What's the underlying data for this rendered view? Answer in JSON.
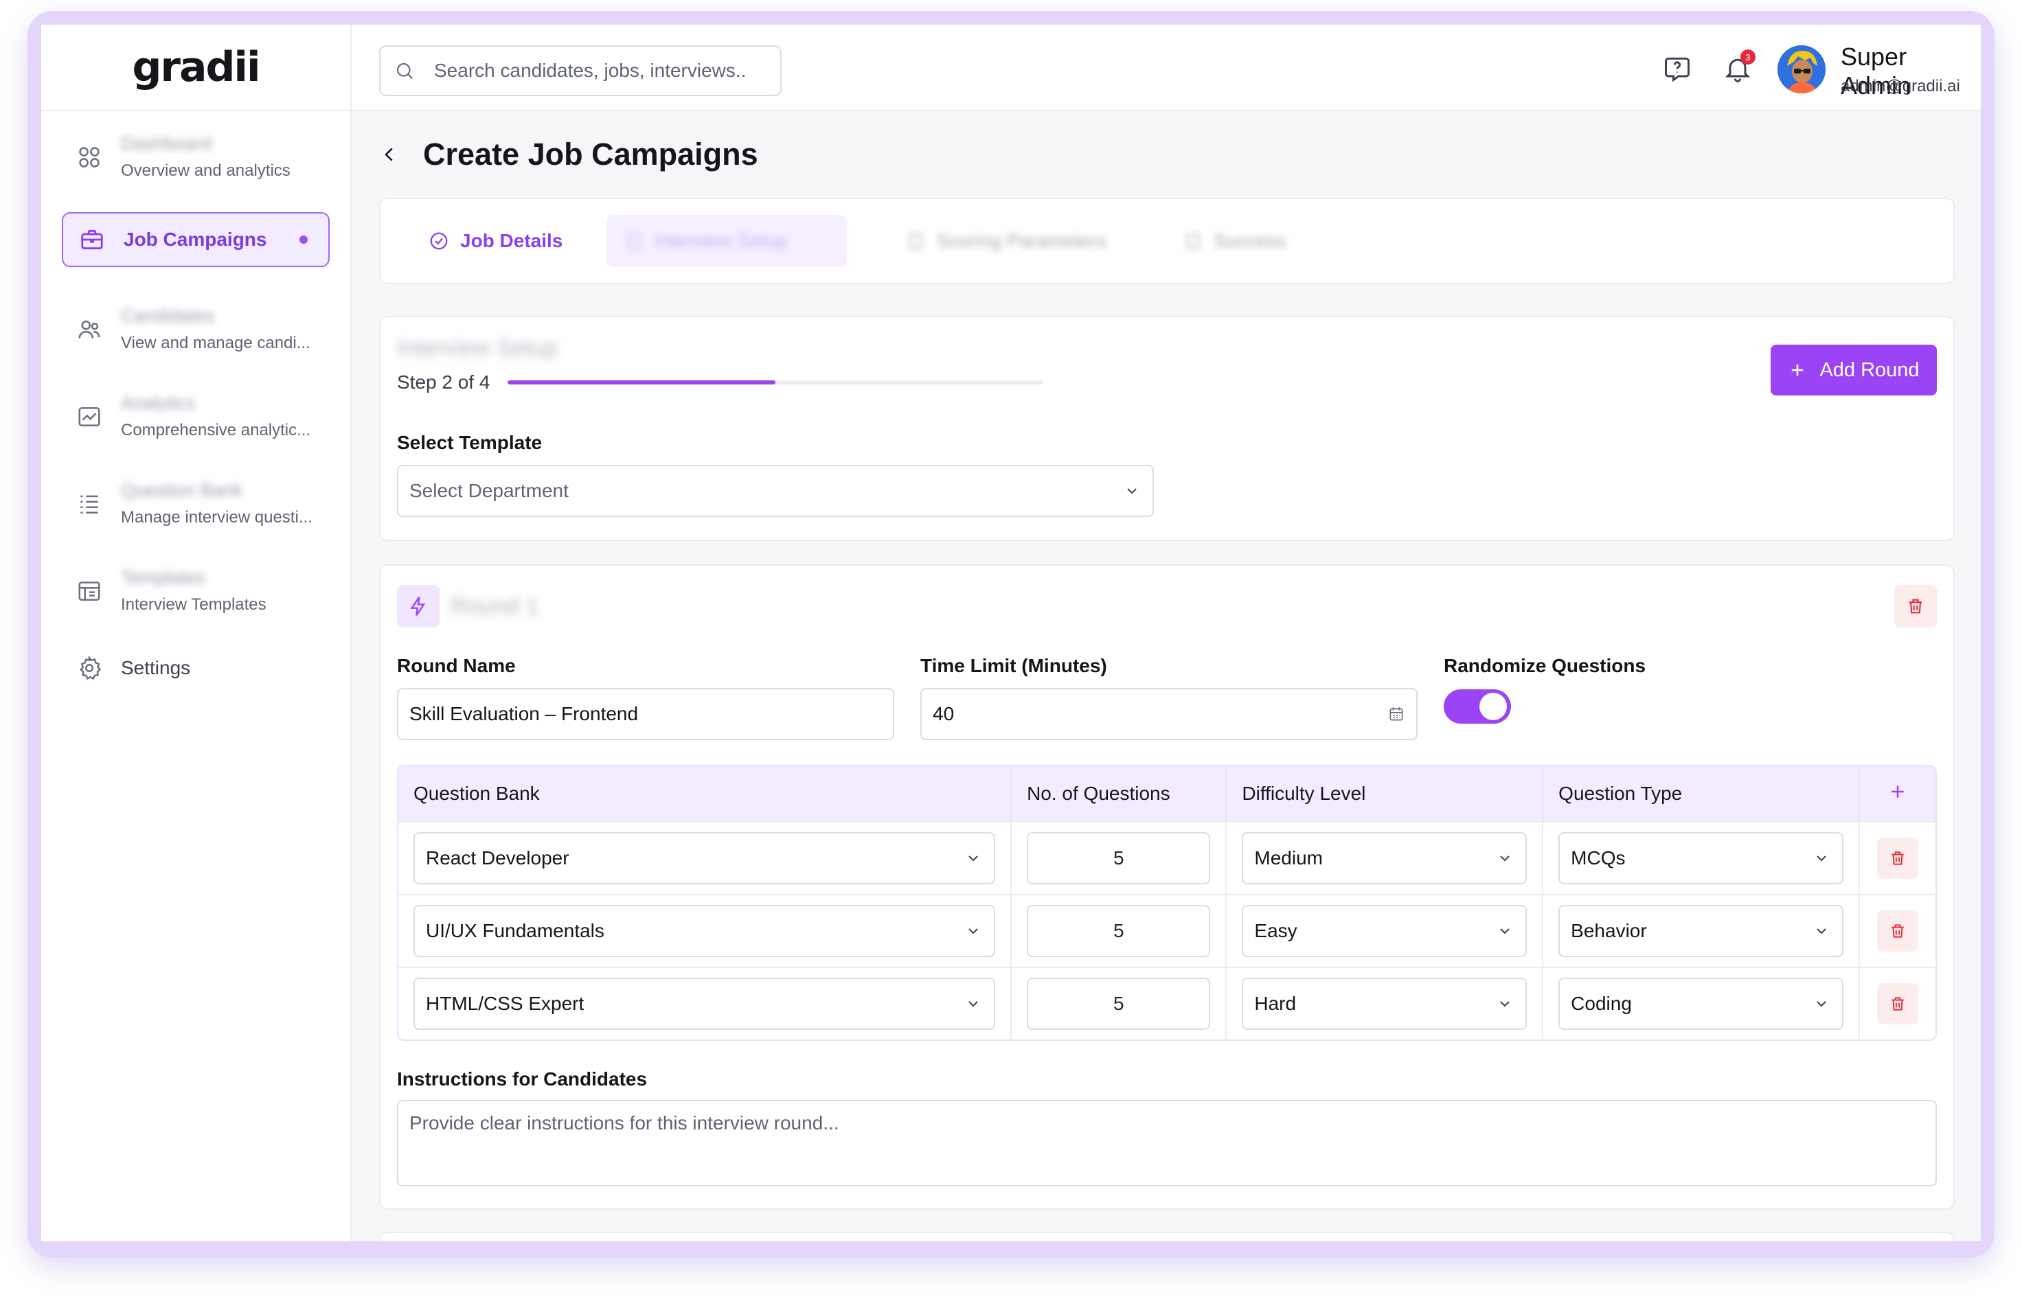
{
  "brand": {
    "logo": "gradii"
  },
  "search": {
    "placeholder": "Search candidates, jobs, interviews.."
  },
  "header": {
    "notification_count": "3",
    "user_name": "Super Admin",
    "user_email": "admin@gradii.ai"
  },
  "sidebar": {
    "items": [
      {
        "title": "Dashboard",
        "subtitle": "Overview and analytics",
        "icon": "grid-icon"
      },
      {
        "title": "Job Campaigns",
        "icon": "briefcase-icon",
        "active": true
      },
      {
        "title": "Candidates",
        "subtitle": "View and manage candi...",
        "icon": "users-icon"
      },
      {
        "title": "Analytics",
        "subtitle": "Comprehensive analytic...",
        "icon": "chart-icon"
      },
      {
        "title": "Question Bank",
        "subtitle": "Manage interview questi...",
        "icon": "list-icon"
      },
      {
        "title": "Templates",
        "subtitle": "Interview Templates",
        "icon": "template-icon"
      },
      {
        "title": "Settings",
        "icon": "gear-icon"
      }
    ]
  },
  "page": {
    "title": "Create Job Campaigns"
  },
  "stepper": {
    "steps": [
      {
        "label": "Job Details",
        "state": "done"
      },
      {
        "label": "Interview Setup",
        "state": "current"
      },
      {
        "label": "Scoring Parameters",
        "state": "upcoming"
      },
      {
        "label": "Success",
        "state": "upcoming"
      }
    ]
  },
  "setup": {
    "title": "Interview Setup",
    "step_text": "Step 2 of 4",
    "progress": 0.5,
    "add_round_label": "Add Round",
    "template_label": "Select Template",
    "template_placeholder": "Select Department"
  },
  "round": {
    "title": "Round 1",
    "name_label": "Round Name",
    "name_value": "Skill Evaluation – Frontend",
    "time_label": "Time Limit (Minutes)",
    "time_value": "40",
    "randomize_label": "Randomize Questions",
    "randomize_on": true,
    "table": {
      "headers": [
        "Question Bank",
        "No. of Questions",
        "Difficulty Level",
        "Question Type"
      ],
      "rows": [
        {
          "bank": "React Developer",
          "count": "5",
          "difficulty": "Medium",
          "type": "MCQs"
        },
        {
          "bank": "UI/UX Fundamentals",
          "count": "5",
          "difficulty": "Easy",
          "type": "Behavior"
        },
        {
          "bank": "HTML/CSS Expert",
          "count": "5",
          "difficulty": "Hard",
          "type": "Coding"
        }
      ]
    },
    "instructions_label": "Instructions for Candidates",
    "instructions_placeholder": "Provide clear instructions for this interview round..."
  },
  "colors": {
    "accent": "#9A44F6",
    "accent_light": "#F3EBFF",
    "danger": "#E5283A",
    "danger_light": "#FDECEC"
  }
}
